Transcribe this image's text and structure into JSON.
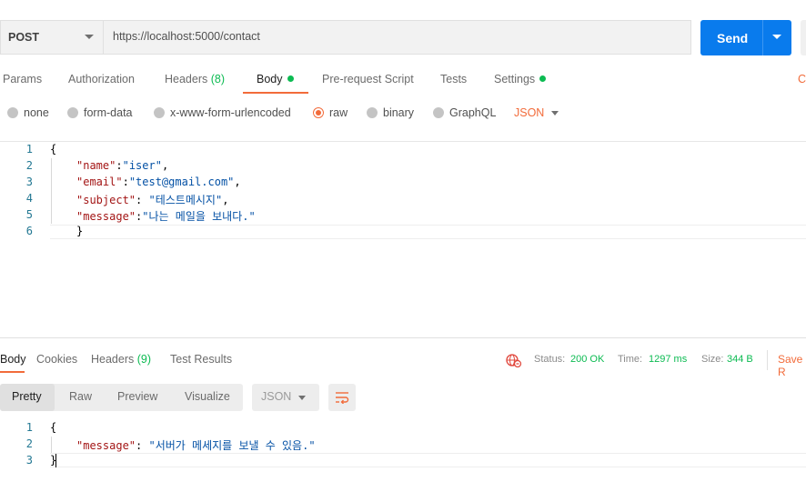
{
  "request": {
    "method": "POST",
    "url": "https://localhost:5000/contact",
    "send_label": "Send"
  },
  "tabs": [
    {
      "label": "Params"
    },
    {
      "label": "Authorization"
    },
    {
      "label": "Headers",
      "count": "(8)"
    },
    {
      "label": "Body",
      "active": true
    },
    {
      "label": "Pre-request Script"
    },
    {
      "label": "Tests"
    },
    {
      "label": "Settings"
    }
  ],
  "cookies_partial": "C",
  "body_types": [
    "none",
    "form-data",
    "x-www-form-urlencoded",
    "raw",
    "binary",
    "GraphQL"
  ],
  "body_type_selected": "raw",
  "body_format": "JSON",
  "request_body": {
    "line_numbers": [
      "1",
      "2",
      "3",
      "4",
      "5",
      "6"
    ],
    "open": "{",
    "close": "}",
    "fields": [
      {
        "key": "\"name\"",
        "sep": ":",
        "value": "\"iser\"",
        "trail": ","
      },
      {
        "key": "\"email\"",
        "sep": ":",
        "value": "\"test@gmail.com\"",
        "trail": ","
      },
      {
        "key": "\"subject\"",
        "sep": ": ",
        "value": "\"테스트메시지\"",
        "trail": ","
      },
      {
        "key": "\"message\"",
        "sep": ":",
        "value": "\"나는 메일을 보내다.\"",
        "trail": ""
      }
    ]
  },
  "response": {
    "tabs": [
      {
        "label": "Body",
        "active": true
      },
      {
        "label": "Cookies"
      },
      {
        "label": "Headers",
        "count": "(9)"
      },
      {
        "label": "Test Results"
      }
    ],
    "status_label": "Status:",
    "status_value": "200 OK",
    "time_label": "Time:",
    "time_value": "1297 ms",
    "size_label": "Size:",
    "size_value": "344 B",
    "save_partial": "Save R",
    "views": [
      "Pretty",
      "Raw",
      "Preview",
      "Visualize"
    ],
    "format": "JSON",
    "body": {
      "line_numbers": [
        "1",
        "2",
        "3"
      ],
      "open": "{",
      "close": "}",
      "key": "\"message\"",
      "sep": ": ",
      "value": "\"서버가 메세지를 보낼 수 있음.\""
    }
  },
  "colors": {
    "accent": "#f26b3a",
    "send": "#097bed",
    "ok": "#0cbb52"
  }
}
